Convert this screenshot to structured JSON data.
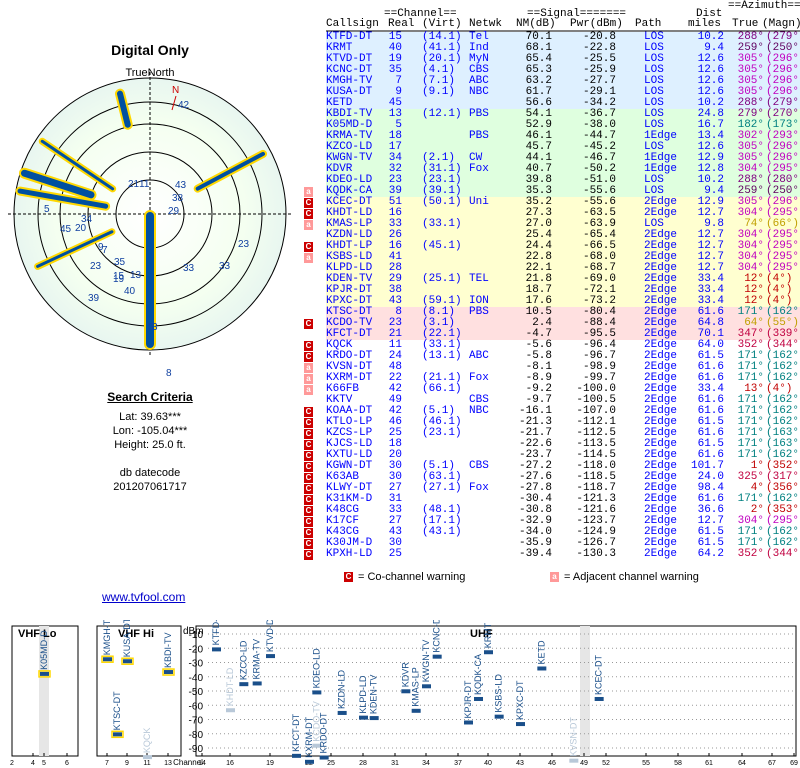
{
  "polar": {
    "title": "Digital Only",
    "north_label": "TrueNorth",
    "north_marker": "N",
    "labels": [
      "42",
      "21",
      "11",
      "43",
      "38",
      "29",
      "5",
      "3",
      "34",
      "33",
      "15",
      "7",
      "19",
      "35",
      "20",
      "9",
      "13",
      "40",
      "23",
      "39",
      "23",
      "33",
      "45",
      "8",
      "24",
      "48",
      "22",
      "5"
    ]
  },
  "criteria": {
    "heading": "Search Criteria",
    "lat": "Lat: 39.63***",
    "lon": "Lon: -105.04***",
    "height": "Height: 25.0 ft.",
    "db_label": "db datecode",
    "db_value": "201207061717"
  },
  "link": "www.tvfool.com",
  "table_header": {
    "channel_group": "==Channel==",
    "signal_group": "==Signal=======",
    "dist_top": "Dist",
    "azimuth_group": "==Azimuth==",
    "callsign": "Callsign",
    "real": "Real",
    "virt": "(Virt)",
    "netwk": "Netwk",
    "nm": "NM(dB)",
    "pwr": "Pwr(dBm)",
    "path": "Path",
    "miles": "miles",
    "true_az": "True",
    "magn": "(Magn)"
  },
  "stations": [
    {
      "callsign": "KTFD-DT",
      "real": "15",
      "virt": "(14.1)",
      "netwk": "Tel",
      "nm": "70.1",
      "pwr": "-20.8",
      "path": "LOS",
      "dist": "10.2",
      "true": "288°",
      "magn": "(279°)",
      "bg": "#def0ff",
      "tc": "#800080",
      "warn": ""
    },
    {
      "callsign": "KRMT",
      "real": "40",
      "virt": "(41.1)",
      "netwk": "Ind",
      "nm": "68.1",
      "pwr": "-22.8",
      "path": "LOS",
      "dist": "9.4",
      "true": "259°",
      "magn": "(250°)",
      "bg": "#def0ff",
      "tc": "#600060",
      "warn": ""
    },
    {
      "callsign": "KTVD-DT",
      "real": "19",
      "virt": "(20.1)",
      "netwk": "MyN",
      "nm": "65.4",
      "pwr": "-25.5",
      "path": "LOS",
      "dist": "12.6",
      "true": "305°",
      "magn": "(296°)",
      "bg": "#def0ff",
      "tc": "#c000c0",
      "warn": ""
    },
    {
      "callsign": "KCNC-DT",
      "real": "35",
      "virt": "(4.1)",
      "netwk": "CBS",
      "nm": "65.3",
      "pwr": "-25.9",
      "path": "LOS",
      "dist": "12.6",
      "true": "305°",
      "magn": "(296°)",
      "bg": "#def0ff",
      "tc": "#c000c0",
      "warn": ""
    },
    {
      "callsign": "KMGH-TV",
      "real": "7",
      "virt": "(7.1)",
      "netwk": "ABC",
      "nm": "63.2",
      "pwr": "-27.7",
      "path": "LOS",
      "dist": "12.6",
      "true": "305°",
      "magn": "(296°)",
      "bg": "#def0ff",
      "tc": "#c000c0",
      "warn": ""
    },
    {
      "callsign": "KUSA-DT",
      "real": "9",
      "virt": "(9.1)",
      "netwk": "NBC",
      "nm": "61.7",
      "pwr": "-29.1",
      "path": "LOS",
      "dist": "12.6",
      "true": "305°",
      "magn": "(296°)",
      "bg": "#def0ff",
      "tc": "#c000c0",
      "warn": ""
    },
    {
      "callsign": "KETD",
      "real": "45",
      "virt": "",
      "netwk": "",
      "nm": "56.6",
      "pwr": "-34.2",
      "path": "LOS",
      "dist": "10.2",
      "true": "288°",
      "magn": "(279°)",
      "bg": "#def0ff",
      "tc": "#800080",
      "warn": ""
    },
    {
      "callsign": "KBDI-TV",
      "real": "13",
      "virt": "(12.1)",
      "netwk": "PBS",
      "nm": "54.1",
      "pwr": "-36.7",
      "path": "LOS",
      "dist": "24.8",
      "true": "279°",
      "magn": "(270°)",
      "bg": "#dfffdf",
      "tc": "#800080",
      "warn": ""
    },
    {
      "callsign": "K05MD-D",
      "real": "5",
      "virt": "",
      "netwk": "",
      "nm": "52.9",
      "pwr": "-38.0",
      "path": "LOS",
      "dist": "16.7",
      "true": "182°",
      "magn": "(173°)",
      "bg": "#dfffdf",
      "tc": "#008080",
      "warn": ""
    },
    {
      "callsign": "KRMA-TV",
      "real": "18",
      "virt": "",
      "netwk": "PBS",
      "nm": "46.1",
      "pwr": "-44.7",
      "path": "1Edge",
      "dist": "13.4",
      "true": "302°",
      "magn": "(293°)",
      "bg": "#dfffdf",
      "tc": "#c000c0",
      "warn": ""
    },
    {
      "callsign": "KZCO-LD",
      "real": "17",
      "virt": "",
      "netwk": "",
      "nm": "45.7",
      "pwr": "-45.2",
      "path": "LOS",
      "dist": "12.6",
      "true": "305°",
      "magn": "(296°)",
      "bg": "#dfffdf",
      "tc": "#c000c0",
      "warn": ""
    },
    {
      "callsign": "KWGN-TV",
      "real": "34",
      "virt": "(2.1)",
      "netwk": "CW",
      "nm": "44.1",
      "pwr": "-46.7",
      "path": "1Edge",
      "dist": "12.9",
      "true": "305°",
      "magn": "(296°)",
      "bg": "#dfffdf",
      "tc": "#c000c0",
      "warn": ""
    },
    {
      "callsign": "KDVR",
      "real": "32",
      "virt": "(31.1)",
      "netwk": "Fox",
      "nm": "40.7",
      "pwr": "-50.2",
      "path": "1Edge",
      "dist": "12.8",
      "true": "304°",
      "magn": "(295°)",
      "bg": "#dfffdf",
      "tc": "#c000c0",
      "warn": ""
    },
    {
      "callsign": "KDEO-LD",
      "real": "23",
      "virt": "(23.1)",
      "netwk": "",
      "nm": "39.8",
      "pwr": "-51.0",
      "path": "LOS",
      "dist": "10.2",
      "true": "288°",
      "magn": "(280°)",
      "bg": "#dfffdf",
      "tc": "#800080",
      "warn": ""
    },
    {
      "callsign": "KQDK-CA",
      "real": "39",
      "virt": "(39.1)",
      "netwk": "",
      "nm": "35.3",
      "pwr": "-55.6",
      "path": "LOS",
      "dist": "9.4",
      "true": "259°",
      "magn": "(250°)",
      "bg": "#dfffdf",
      "tc": "#600060",
      "warn": "adj"
    },
    {
      "callsign": "KCEC-DT",
      "real": "51",
      "virt": "(50.1)",
      "netwk": "Uni",
      "nm": "35.2",
      "pwr": "-55.6",
      "path": "2Edge",
      "dist": "12.9",
      "true": "305°",
      "magn": "(296°)",
      "bg": "#ffffd0",
      "tc": "#c000c0",
      "warn": "co"
    },
    {
      "callsign": "KHDT-LD",
      "real": "16",
      "virt": "",
      "netwk": "",
      "nm": "27.3",
      "pwr": "-63.5",
      "path": "2Edge",
      "dist": "12.7",
      "true": "304°",
      "magn": "(295°)",
      "bg": "#ffffd0",
      "tc": "#c000c0",
      "warn": "co"
    },
    {
      "callsign": "KMAS-LP",
      "real": "33",
      "virt": "(33.1)",
      "netwk": "",
      "nm": "27.0",
      "pwr": "-63.9",
      "path": "LOS",
      "dist": "9.8",
      "true": "74°",
      "magn": "(66°)",
      "bg": "#ffffd0",
      "tc": "#c0a000",
      "warn": "adj"
    },
    {
      "callsign": "KZDN-LD",
      "real": "26",
      "virt": "",
      "netwk": "",
      "nm": "25.4",
      "pwr": "-65.4",
      "path": "2Edge",
      "dist": "12.7",
      "true": "304°",
      "magn": "(295°)",
      "bg": "#ffffd0",
      "tc": "#c000c0",
      "warn": ""
    },
    {
      "callsign": "KHDT-LP",
      "real": "16",
      "virt": "(45.1)",
      "netwk": "",
      "nm": "24.4",
      "pwr": "-66.5",
      "path": "2Edge",
      "dist": "12.7",
      "true": "304°",
      "magn": "(295°)",
      "bg": "#ffffd0",
      "tc": "#c000c0",
      "warn": "co"
    },
    {
      "callsign": "KSBS-LD",
      "real": "41",
      "virt": "",
      "netwk": "",
      "nm": "22.8",
      "pwr": "-68.0",
      "path": "2Edge",
      "dist": "12.7",
      "true": "304°",
      "magn": "(295°)",
      "bg": "#ffffd0",
      "tc": "#c000c0",
      "warn": "adj"
    },
    {
      "callsign": "KLPD-LD",
      "real": "28",
      "virt": "",
      "netwk": "",
      "nm": "22.1",
      "pwr": "-68.7",
      "path": "2Edge",
      "dist": "12.7",
      "true": "304°",
      "magn": "(295°)",
      "bg": "#ffffd0",
      "tc": "#c000c0",
      "warn": ""
    },
    {
      "callsign": "KDEN-TV",
      "real": "29",
      "virt": "(25.1)",
      "netwk": "TEL",
      "nm": "21.8",
      "pwr": "-69.0",
      "path": "2Edge",
      "dist": "33.4",
      "true": "12°",
      "magn": "(4°)",
      "bg": "#ffffd0",
      "tc": "#c00000",
      "warn": ""
    },
    {
      "callsign": "KPJR-DT",
      "real": "38",
      "virt": "",
      "netwk": "",
      "nm": "18.7",
      "pwr": "-72.1",
      "path": "2Edge",
      "dist": "33.4",
      "true": "12°",
      "magn": "(4°)",
      "bg": "#ffffd0",
      "tc": "#c00000",
      "warn": ""
    },
    {
      "callsign": "KPXC-DT",
      "real": "43",
      "virt": "(59.1)",
      "netwk": "ION",
      "nm": "17.6",
      "pwr": "-73.2",
      "path": "2Edge",
      "dist": "33.4",
      "true": "12°",
      "magn": "(4°)",
      "bg": "#ffffd0",
      "tc": "#c00000",
      "warn": ""
    },
    {
      "callsign": "KTSC-DT",
      "real": "8",
      "virt": "(8.1)",
      "netwk": "PBS",
      "nm": "10.5",
      "pwr": "-80.4",
      "path": "2Edge",
      "dist": "61.6",
      "true": "171°",
      "magn": "(162°)",
      "bg": "#ffe0e0",
      "tc": "#008080",
      "warn": ""
    },
    {
      "callsign": "KCDO-TV",
      "real": "23",
      "virt": "(3.1)",
      "netwk": "",
      "nm": "2.4",
      "pwr": "-88.4",
      "path": "2Edge",
      "dist": "64.8",
      "true": "64°",
      "magn": "(55°)",
      "bg": "#ffe0e0",
      "tc": "#c0a000",
      "warn": "co"
    },
    {
      "callsign": "KFCT-DT",
      "real": "21",
      "virt": "(22.1)",
      "netwk": "",
      "nm": "-4.7",
      "pwr": "-95.5",
      "path": "2Edge",
      "dist": "70.1",
      "true": "347°",
      "magn": "(339°)",
      "bg": "#ffe0e0",
      "tc": "#c00040",
      "warn": ""
    },
    {
      "callsign": "KQCK",
      "real": "11",
      "virt": "(33.1)",
      "netwk": "",
      "nm": "-5.6",
      "pwr": "-96.4",
      "path": "2Edge",
      "dist": "64.0",
      "true": "352°",
      "magn": "(344°)",
      "bg": "#ffffff",
      "tc": "#c00040",
      "warn": "co"
    },
    {
      "callsign": "KRDO-DT",
      "real": "24",
      "virt": "(13.1)",
      "netwk": "ABC",
      "nm": "-5.8",
      "pwr": "-96.7",
      "path": "2Edge",
      "dist": "61.5",
      "true": "171°",
      "magn": "(162°)",
      "bg": "#ffffff",
      "tc": "#008080",
      "warn": "co"
    },
    {
      "callsign": "KVSN-DT",
      "real": "48",
      "virt": "",
      "netwk": "",
      "nm": "-8.1",
      "pwr": "-98.9",
      "path": "2Edge",
      "dist": "61.6",
      "true": "171°",
      "magn": "(162°)",
      "bg": "#ffffff",
      "tc": "#008080",
      "warn": "adj"
    },
    {
      "callsign": "KXRM-DT",
      "real": "22",
      "virt": "(21.1)",
      "netwk": "Fox",
      "nm": "-8.9",
      "pwr": "-99.7",
      "path": "2Edge",
      "dist": "61.6",
      "true": "171°",
      "magn": "(162°)",
      "bg": "#ffffff",
      "tc": "#008080",
      "warn": "adj"
    },
    {
      "callsign": "K66FB",
      "real": "42",
      "virt": "(66.1)",
      "netwk": "",
      "nm": "-9.2",
      "pwr": "-100.0",
      "path": "2Edge",
      "dist": "33.4",
      "true": "13°",
      "magn": "(4°)",
      "bg": "#ffffff",
      "tc": "#c00000",
      "warn": "adj"
    },
    {
      "callsign": "KKTV",
      "real": "49",
      "virt": "",
      "netwk": "CBS",
      "nm": "-9.7",
      "pwr": "-100.5",
      "path": "2Edge",
      "dist": "61.6",
      "true": "171°",
      "magn": "(162°)",
      "bg": "#ffffff",
      "tc": "#008080",
      "warn": ""
    },
    {
      "callsign": "KOAA-DT",
      "real": "42",
      "virt": "(5.1)",
      "netwk": "NBC",
      "nm": "-16.1",
      "pwr": "-107.0",
      "path": "2Edge",
      "dist": "61.6",
      "true": "171°",
      "magn": "(162°)",
      "bg": "#ffffff",
      "tc": "#008080",
      "warn": "co"
    },
    {
      "callsign": "KTLO-LP",
      "real": "46",
      "virt": "(46.1)",
      "netwk": "",
      "nm": "-21.3",
      "pwr": "-112.1",
      "path": "2Edge",
      "dist": "61.5",
      "true": "171°",
      "magn": "(162°)",
      "bg": "#ffffff",
      "tc": "#008080",
      "warn": "co"
    },
    {
      "callsign": "KZCS-LP",
      "real": "25",
      "virt": "(23.1)",
      "netwk": "",
      "nm": "-21.7",
      "pwr": "-112.5",
      "path": "2Edge",
      "dist": "61.6",
      "true": "171°",
      "magn": "(163°)",
      "bg": "#ffffff",
      "tc": "#008080",
      "warn": "co"
    },
    {
      "callsign": "KJCS-LD",
      "real": "18",
      "virt": "",
      "netwk": "",
      "nm": "-22.6",
      "pwr": "-113.5",
      "path": "2Edge",
      "dist": "61.5",
      "true": "171°",
      "magn": "(163°)",
      "bg": "#ffffff",
      "tc": "#008080",
      "warn": "co"
    },
    {
      "callsign": "KXTU-LD",
      "real": "20",
      "virt": "",
      "netwk": "",
      "nm": "-23.7",
      "pwr": "-114.5",
      "path": "2Edge",
      "dist": "61.6",
      "true": "171°",
      "magn": "(162°)",
      "bg": "#ffffff",
      "tc": "#008080",
      "warn": "co"
    },
    {
      "callsign": "KGWN-DT",
      "real": "30",
      "virt": "(5.1)",
      "netwk": "CBS",
      "nm": "-27.2",
      "pwr": "-118.0",
      "path": "2Edge",
      "dist": "101.7",
      "true": "1°",
      "magn": "(352°)",
      "bg": "#ffffff",
      "tc": "#c00000",
      "warn": "co"
    },
    {
      "callsign": "K63AB",
      "real": "30",
      "virt": "(63.1)",
      "netwk": "",
      "nm": "-27.6",
      "pwr": "-118.5",
      "path": "2Edge",
      "dist": "24.0",
      "true": "325°",
      "magn": "(317°)",
      "bg": "#ffffff",
      "tc": "#c00040",
      "warn": "co"
    },
    {
      "callsign": "KLWY-DT",
      "real": "27",
      "virt": "(27.1)",
      "netwk": "Fox",
      "nm": "-27.8",
      "pwr": "-118.7",
      "path": "2Edge",
      "dist": "98.4",
      "true": "4°",
      "magn": "(356°)",
      "bg": "#ffffff",
      "tc": "#c00000",
      "warn": "co"
    },
    {
      "callsign": "K31KM-D",
      "real": "31",
      "virt": "",
      "netwk": "",
      "nm": "-30.4",
      "pwr": "-121.3",
      "path": "2Edge",
      "dist": "61.6",
      "true": "171°",
      "magn": "(162°)",
      "bg": "#ffffff",
      "tc": "#008080",
      "warn": "co"
    },
    {
      "callsign": "K48CG",
      "real": "33",
      "virt": "(48.1)",
      "netwk": "",
      "nm": "-30.8",
      "pwr": "-121.6",
      "path": "2Edge",
      "dist": "36.6",
      "true": "2°",
      "magn": "(353°)",
      "bg": "#ffffff",
      "tc": "#c00000",
      "warn": "co"
    },
    {
      "callsign": "K17CF",
      "real": "27",
      "virt": "(17.1)",
      "netwk": "",
      "nm": "-32.9",
      "pwr": "-123.7",
      "path": "2Edge",
      "dist": "12.7",
      "true": "304°",
      "magn": "(295°)",
      "bg": "#ffffff",
      "tc": "#c000c0",
      "warn": "co"
    },
    {
      "callsign": "K43CG",
      "real": "43",
      "virt": "(43.1)",
      "netwk": "",
      "nm": "-34.0",
      "pwr": "-124.9",
      "path": "2Edge",
      "dist": "61.5",
      "true": "171°",
      "magn": "(162°)",
      "bg": "#ffffff",
      "tc": "#008080",
      "warn": "co"
    },
    {
      "callsign": "K30JM-D",
      "real": "30",
      "virt": "",
      "netwk": "",
      "nm": "-35.9",
      "pwr": "-126.7",
      "path": "2Edge",
      "dist": "61.5",
      "true": "171°",
      "magn": "(162°)",
      "bg": "#ffffff",
      "tc": "#008080",
      "warn": "co"
    },
    {
      "callsign": "KPXH-LD",
      "real": "25",
      "virt": "",
      "netwk": "",
      "nm": "-39.4",
      "pwr": "-130.3",
      "path": "2Edge",
      "dist": "64.2",
      "true": "352°",
      "magn": "(344°)",
      "bg": "#ffffff",
      "tc": "#c00040",
      "warn": "co"
    }
  ],
  "legend": {
    "co_icon": "C",
    "co_label": "= Co-channel warning",
    "adj_icon": "a",
    "adj_label": "= Adjacent channel warning"
  },
  "spectrum": {
    "vhf_lo": "VHF Lo",
    "vhf_hi": "VHF Hi",
    "uhf": "UHF",
    "dbm_label": "dBm",
    "channel_label": "Channel",
    "y_ticks": [
      "-10",
      "-20",
      "-30",
      "-40",
      "-50",
      "-60",
      "-70",
      "-80",
      "-90"
    ],
    "x_ticks": [
      "2",
      "4",
      "5",
      "6",
      "7",
      "9",
      "11",
      "13",
      "14",
      "16",
      "19",
      "22",
      "25",
      "28",
      "31",
      "34",
      "37",
      "40",
      "43",
      "46",
      "49",
      "52",
      "55",
      "58",
      "61",
      "64",
      "67",
      "69"
    ],
    "marks": [
      {
        "label": "K05MD-D",
        "ch": 5,
        "pwr": -38.0,
        "faded": false
      },
      {
        "label": "KMGH-TV",
        "ch": 7,
        "pwr": -27.7,
        "faded": false
      },
      {
        "label": "KUSA-DT",
        "ch": 9,
        "pwr": -29.1,
        "faded": false
      },
      {
        "label": "KTSC-DT",
        "ch": 8,
        "pwr": -80.4,
        "faded": false
      },
      {
        "label": "KQCK",
        "ch": 11,
        "pwr": -96.4,
        "faded": true
      },
      {
        "label": "KBDI-TV",
        "ch": 13,
        "pwr": -36.7,
        "faded": false
      },
      {
        "label": "KTFD-DT",
        "ch": 15,
        "pwr": -20.8,
        "faded": false
      },
      {
        "label": "KHDT-LD",
        "ch": 16,
        "pwr": -63.5,
        "faded": true
      },
      {
        "label": "KZCO-LD",
        "ch": 17,
        "pwr": -45.2,
        "faded": false
      },
      {
        "label": "KRMA-TV",
        "ch": 18,
        "pwr": -44.7,
        "faded": false
      },
      {
        "label": "KTVD-DT",
        "ch": 19,
        "pwr": -25.5,
        "faded": false
      },
      {
        "label": "KFCT-DT",
        "ch": 21,
        "pwr": -95.5,
        "faded": false
      },
      {
        "label": "KXRM-DT",
        "ch": 22,
        "pwr": -99.7,
        "faded": false
      },
      {
        "label": "KCDO-TV",
        "ch": 23,
        "pwr": -88.4,
        "faded": true
      },
      {
        "label": "KDEO-LD",
        "ch": 23,
        "pwr": -51.0,
        "faded": false
      },
      {
        "label": "KRDO-DT",
        "ch": 24,
        "pwr": -96.7,
        "faded": false
      },
      {
        "label": "KZDN-LD",
        "ch": 26,
        "pwr": -65.4,
        "faded": false
      },
      {
        "label": "KLPD-LD",
        "ch": 28,
        "pwr": -68.7,
        "faded": false
      },
      {
        "label": "KDEN-TV",
        "ch": 29,
        "pwr": -69.0,
        "faded": false
      },
      {
        "label": "KDVR",
        "ch": 32,
        "pwr": -50.2,
        "faded": false
      },
      {
        "label": "KMAS-LP",
        "ch": 33,
        "pwr": -63.9,
        "faded": false
      },
      {
        "label": "KWGN-TV",
        "ch": 34,
        "pwr": -46.7,
        "faded": false
      },
      {
        "label": "KCNC-DT",
        "ch": 35,
        "pwr": -25.9,
        "faded": false
      },
      {
        "label": "KPJR-DT",
        "ch": 38,
        "pwr": -72.1,
        "faded": false
      },
      {
        "label": "KQDK-CA",
        "ch": 39,
        "pwr": -55.6,
        "faded": false
      },
      {
        "label": "KRMT",
        "ch": 40,
        "pwr": -22.8,
        "faded": false
      },
      {
        "label": "KSBS-LD",
        "ch": 41,
        "pwr": -68.0,
        "faded": false
      },
      {
        "label": "KPXC-DT",
        "ch": 43,
        "pwr": -73.2,
        "faded": false
      },
      {
        "label": "KETD",
        "ch": 45,
        "pwr": -34.2,
        "faded": false
      },
      {
        "label": "KVSN-DT",
        "ch": 48,
        "pwr": -98.9,
        "faded": true
      },
      {
        "label": "KCEC-DT",
        "ch": 51,
        "pwr": -55.6,
        "faded": false
      }
    ]
  }
}
